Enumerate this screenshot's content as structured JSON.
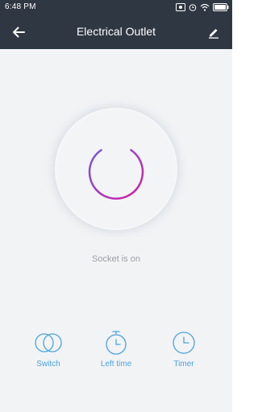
{
  "status_bar": {
    "time": "6:48 PM"
  },
  "header": {
    "title": "Electrical Outlet"
  },
  "main": {
    "power_state": "on",
    "status_text": "Socket is on"
  },
  "controls": [
    {
      "label": "Switch",
      "icon": "switch-icon"
    },
    {
      "label": "Left time",
      "icon": "stopwatch-icon"
    },
    {
      "label": "Timer",
      "icon": "clock-icon"
    }
  ],
  "colors": {
    "header_bg": "#2f3742",
    "background": "#f2f3f5",
    "power_gradient_start": "#6f5bd8",
    "power_gradient_end": "#d21ea3",
    "accent": "#4aa3df"
  }
}
